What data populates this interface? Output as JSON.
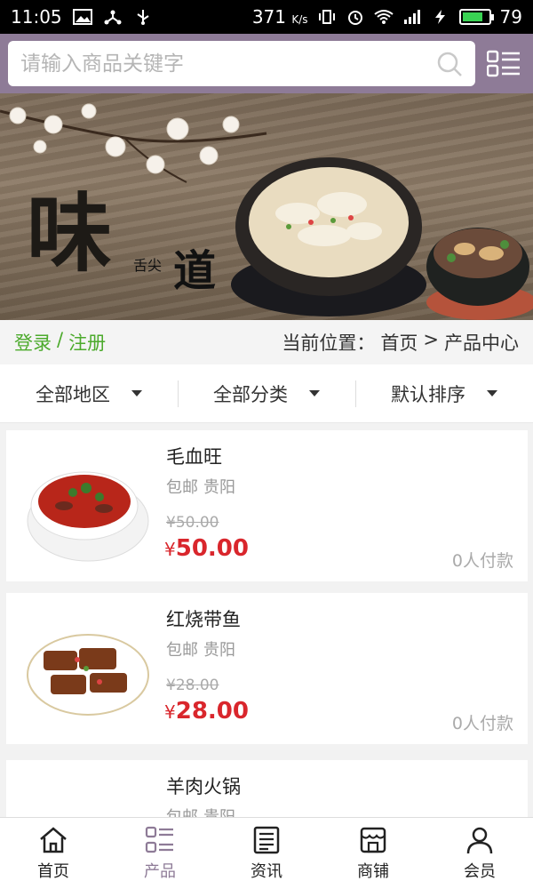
{
  "status_bar": {
    "time": "11:05",
    "speed": "371",
    "speed_unit": "K/s",
    "battery": "79",
    "battery_level": 0.79
  },
  "search": {
    "placeholder": "请输入商品关键字"
  },
  "banner": {
    "title_main": "味",
    "title_small": "舌尖",
    "title_dao": "道"
  },
  "auth": {
    "login": "登录",
    "separator": "/",
    "register": "注册"
  },
  "breadcrumb": {
    "prefix": "当前位置：",
    "home": "首页",
    "arrow": ">",
    "current": "产品中心"
  },
  "filters": [
    {
      "label": "全部地区"
    },
    {
      "label": "全部分类"
    },
    {
      "label": "默认排序"
    }
  ],
  "products": [
    {
      "name": "毛血旺",
      "shipping": "包邮",
      "city": "贵阳",
      "old_price": "¥50.00",
      "currency": "¥",
      "price": "50.00",
      "paid": "0人付款"
    },
    {
      "name": "红烧带鱼",
      "shipping": "包邮",
      "city": "贵阳",
      "old_price": "¥28.00",
      "currency": "¥",
      "price": "28.00",
      "paid": "0人付款"
    },
    {
      "name": "羊肉火锅",
      "shipping": "包邮",
      "city": "贵阳",
      "old_price": "",
      "currency": "",
      "price": "",
      "paid": ""
    }
  ],
  "bottom_nav": [
    {
      "label": "首页",
      "icon": "home-icon"
    },
    {
      "label": "产品",
      "icon": "list-icon"
    },
    {
      "label": "资讯",
      "icon": "news-icon"
    },
    {
      "label": "商铺",
      "icon": "shop-icon"
    },
    {
      "label": "会员",
      "icon": "user-icon"
    }
  ],
  "colors": {
    "header": "#8e7b97",
    "accent_green": "#4caa2c",
    "price_red": "#d9262c"
  }
}
